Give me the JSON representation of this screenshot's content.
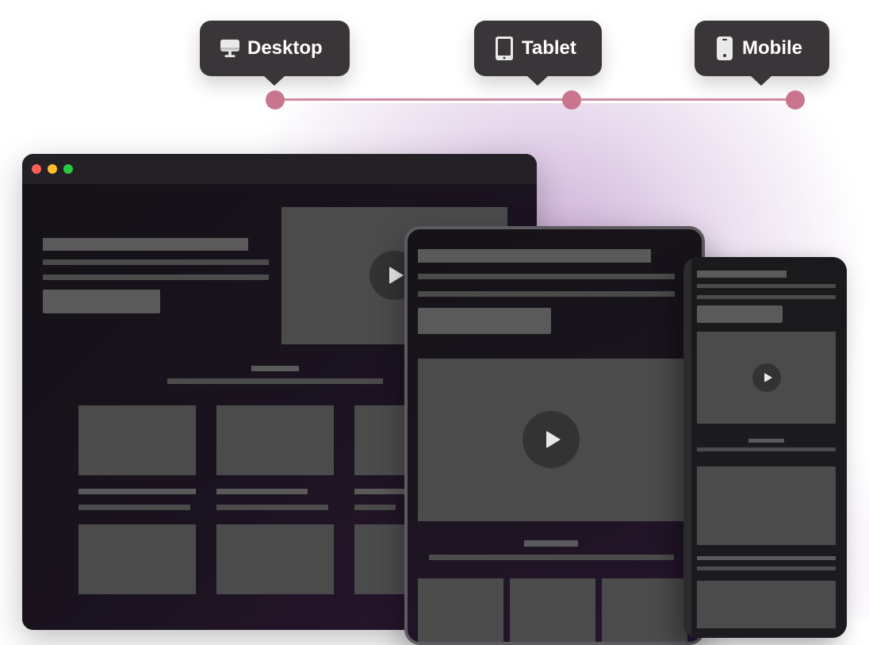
{
  "breakpoints": [
    {
      "label": "Desktop",
      "icon": "desktop-monitor-icon"
    },
    {
      "label": "Tablet",
      "icon": "tablet-icon"
    },
    {
      "label": "Mobile",
      "icon": "mobile-phone-icon"
    }
  ],
  "colors": {
    "tooltip_bg": "#3a3538",
    "track": "#d08ba4",
    "track_dot": "#c9758e",
    "window_bg": "#141216",
    "placeholder_block": "#4b4b4b",
    "traffic_red": "#ff5f57",
    "traffic_yellow": "#febc2e",
    "traffic_green": "#28c840"
  }
}
